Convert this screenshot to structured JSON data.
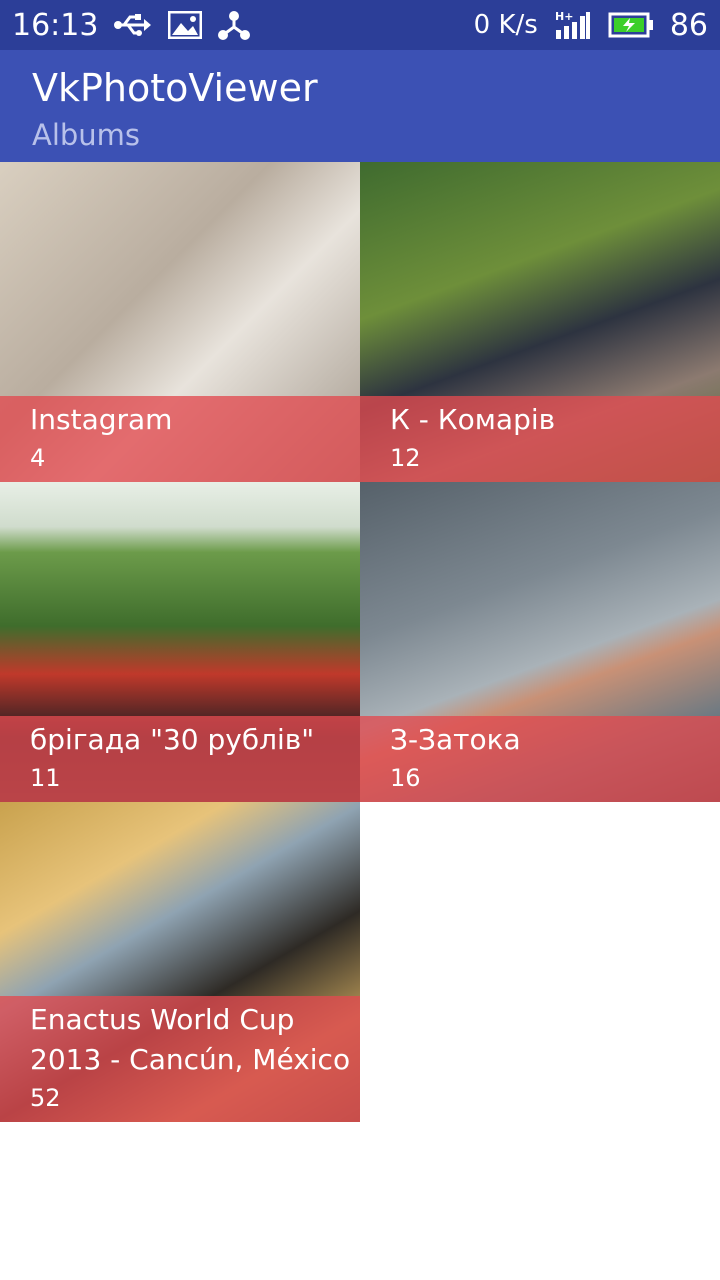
{
  "status_bar": {
    "time": "16:13",
    "icons_left": [
      "usb-icon",
      "image-icon",
      "share-icon"
    ],
    "network_speed": "0 K/s",
    "signal_icon": "signal-h-plus-icon",
    "battery_icon": "battery-charging-icon",
    "battery_percent": "86"
  },
  "app_bar": {
    "title": "VkPhotoViewer",
    "subtitle": "Albums",
    "background_color": "#3c51b4",
    "status_color": "#2c3e98"
  },
  "albums": [
    {
      "title": "Instagram",
      "count": "4"
    },
    {
      "title": "К - Комарів",
      "count": "12"
    },
    {
      "title": "брігада \"30 рублів\"",
      "count": "11"
    },
    {
      "title": "З-Затока",
      "count": "16"
    },
    {
      "title": "Enactus World Cup 2013 - Cancún, México",
      "count": "52"
    }
  ],
  "caption_color": "#e24a50"
}
